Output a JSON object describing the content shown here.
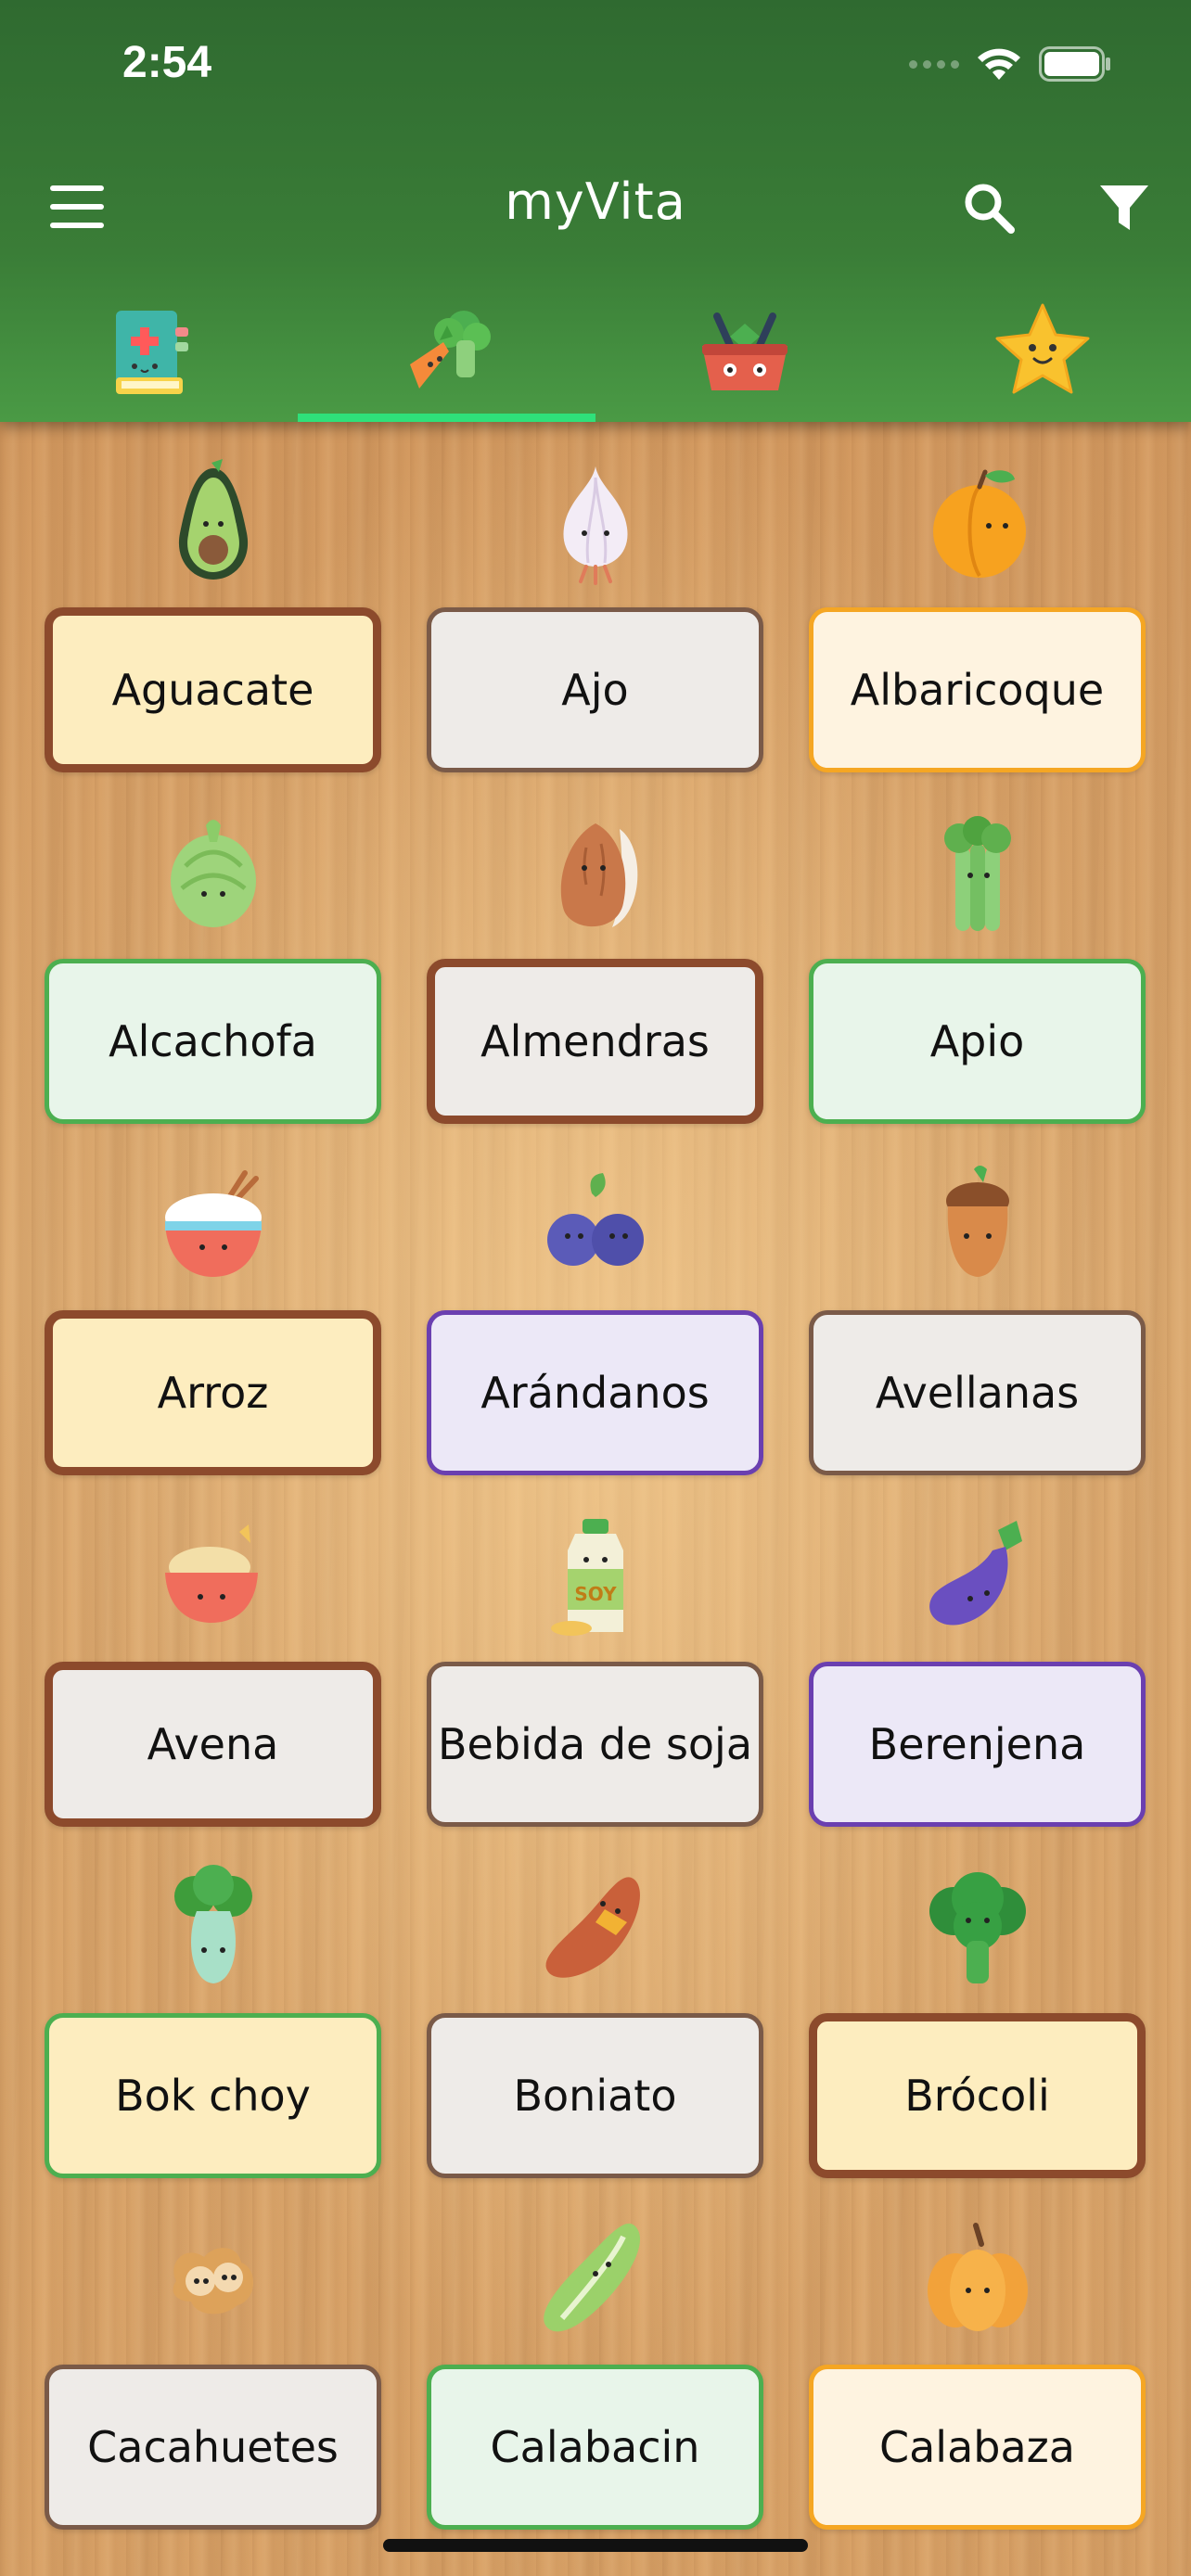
{
  "status_bar": {
    "time": "2:54"
  },
  "header": {
    "title": "myVita",
    "menu_icon": "hamburger-menu-icon",
    "search_icon": "search-icon",
    "filter_icon": "filter-icon",
    "tabs": [
      {
        "icon": "medical-book-icon",
        "active": false
      },
      {
        "icon": "vegetables-icon",
        "active": true
      },
      {
        "icon": "shopping-basket-icon",
        "active": false
      },
      {
        "icon": "star-icon",
        "active": false
      }
    ],
    "accent_color": "#2fe07a"
  },
  "foods": [
    {
      "label": "Aguacate",
      "icon": "avocado-icon",
      "style": "c-brown-cream"
    },
    {
      "label": "Ajo",
      "icon": "garlic-icon",
      "style": "c-brown-grey"
    },
    {
      "label": "Albaricoque",
      "icon": "apricot-icon",
      "style": "c-orange"
    },
    {
      "label": "Alcachofa",
      "icon": "artichoke-icon",
      "style": "c-green"
    },
    {
      "label": "Almendras",
      "icon": "almond-icon",
      "style": "c-brown-grey-thick"
    },
    {
      "label": "Apio",
      "icon": "celery-icon",
      "style": "c-green"
    },
    {
      "label": "Arroz",
      "icon": "rice-bowl-icon",
      "style": "c-brown-cream"
    },
    {
      "label": "Arándanos",
      "icon": "blueberries-icon",
      "style": "c-purple"
    },
    {
      "label": "Avellanas",
      "icon": "hazelnut-icon",
      "style": "c-brown-grey"
    },
    {
      "label": "Avena",
      "icon": "oats-bowl-icon",
      "style": "c-brown-grey-thick"
    },
    {
      "label": "Bebida de soja",
      "icon": "soy-drink-icon",
      "style": "c-grey-thin"
    },
    {
      "label": "Berenjena",
      "icon": "eggplant-icon",
      "style": "c-purple"
    },
    {
      "label": "Bok choy",
      "icon": "bok-choy-icon",
      "style": "c-green-cream"
    },
    {
      "label": "Boniato",
      "icon": "sweet-potato-icon",
      "style": "c-brown-grey"
    },
    {
      "label": "Brócoli",
      "icon": "broccoli-icon",
      "style": "c-brown-cream"
    },
    {
      "label": "Cacahuetes",
      "icon": "peanuts-icon",
      "style": "c-brown-grey"
    },
    {
      "label": "Calabacin",
      "icon": "zucchini-icon",
      "style": "c-green"
    },
    {
      "label": "Calabaza",
      "icon": "pumpkin-icon",
      "style": "c-orange"
    }
  ],
  "soy_label": "SOY"
}
